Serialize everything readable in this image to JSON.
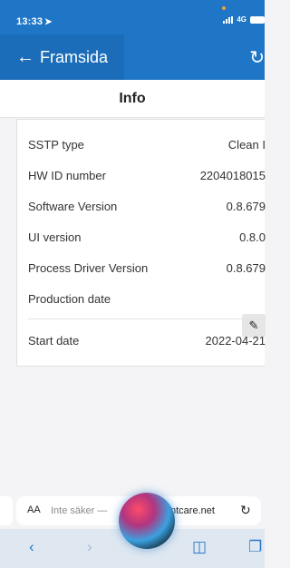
{
  "status_bar": {
    "time": "13:33",
    "network": "4G"
  },
  "nav": {
    "back_label": "Framsida"
  },
  "page": {
    "title": "Info"
  },
  "info_rows": [
    {
      "label": "SSTP type",
      "value": "Clean I"
    },
    {
      "label": "HW ID number",
      "value": "2204018015"
    },
    {
      "label": "Software Version",
      "value": "0.8.679"
    },
    {
      "label": "UI version",
      "value": "0.8.0"
    },
    {
      "label": "Process Driver Version",
      "value": "0.8.679"
    },
    {
      "label": "Production date",
      "value": ""
    },
    {
      "label": "Start date",
      "value": "2022-04-21"
    }
  ],
  "browser": {
    "aa_label": "AA",
    "url_prefix": "Inte säker —",
    "url_domain": "ntcare.net"
  },
  "icons": {
    "back": "arrow-left-icon",
    "refresh": "refresh-icon",
    "edit": "pencil-icon",
    "reload": "reload-icon",
    "bookmarks": "book-icon",
    "tabs": "tabs-icon"
  },
  "colors": {
    "primary": "#1f76c6",
    "toolbar": "#dfe8f1"
  }
}
